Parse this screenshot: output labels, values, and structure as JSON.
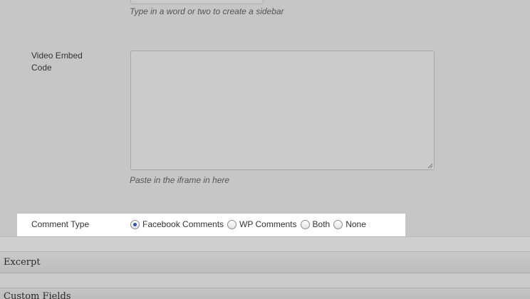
{
  "sidebar_field": {
    "hint": "Type in a word or two to create a sidebar"
  },
  "video_embed": {
    "label": "Video Embed Code",
    "value": "",
    "hint": "Paste in the iframe in here"
  },
  "comment_type": {
    "label": "Comment Type",
    "options": [
      {
        "label": "Facebook Comments",
        "checked": true
      },
      {
        "label": "WP Comments",
        "checked": false
      },
      {
        "label": "Both",
        "checked": false
      },
      {
        "label": "None",
        "checked": false
      }
    ]
  },
  "panels": {
    "excerpt_title": "Excerpt",
    "custom_fields_title": "Custom Fields"
  },
  "colors": {
    "background": "#c6c6c6",
    "highlight": "#ffffff",
    "radio_selected": "#2a55a8"
  }
}
